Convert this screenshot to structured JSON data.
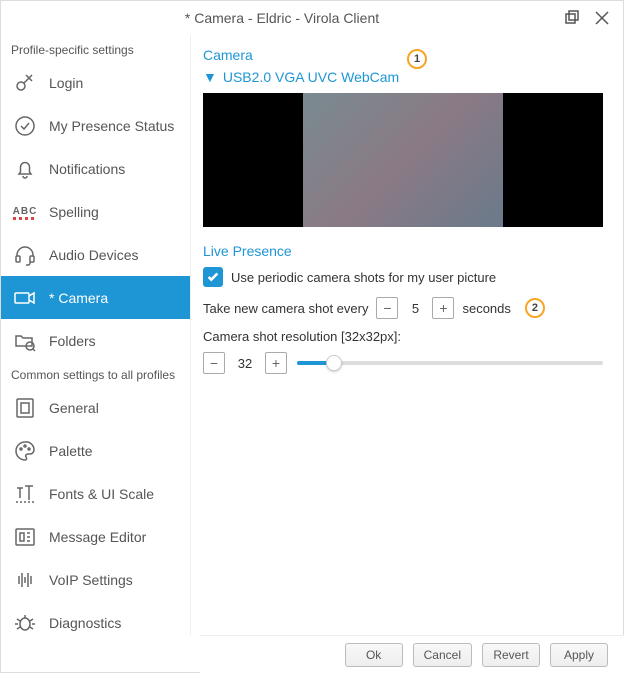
{
  "window": {
    "title": "* Camera - Eldric - Virola Client"
  },
  "sidebar": {
    "profile_label": "Profile-specific settings",
    "common_label": "Common settings to all profiles",
    "profile_items": [
      {
        "label": "Login"
      },
      {
        "label": "My Presence Status"
      },
      {
        "label": "Notifications"
      },
      {
        "label": "Spelling"
      },
      {
        "label": "Audio Devices"
      },
      {
        "label": "* Camera"
      },
      {
        "label": "Folders"
      }
    ],
    "common_items": [
      {
        "label": "General"
      },
      {
        "label": "Palette"
      },
      {
        "label": "Fonts & UI Scale"
      },
      {
        "label": "Message Editor"
      },
      {
        "label": "VoIP Settings"
      },
      {
        "label": "Diagnostics"
      }
    ]
  },
  "camera": {
    "section_title": "Camera",
    "selected_device": "USB2.0 VGA UVC WebCam"
  },
  "live": {
    "section_title": "Live Presence",
    "checkbox_label": "Use periodic camera shots for my user picture",
    "checked": true,
    "interval_label_pre": "Take new camera shot every",
    "interval_value": "5",
    "interval_label_post": "seconds",
    "resolution_label": "Camera shot resolution [32x32px]:",
    "resolution_value": "32"
  },
  "callouts": {
    "one": "1",
    "two": "2"
  },
  "footer": {
    "ok": "Ok",
    "cancel": "Cancel",
    "revert": "Revert",
    "apply": "Apply"
  }
}
